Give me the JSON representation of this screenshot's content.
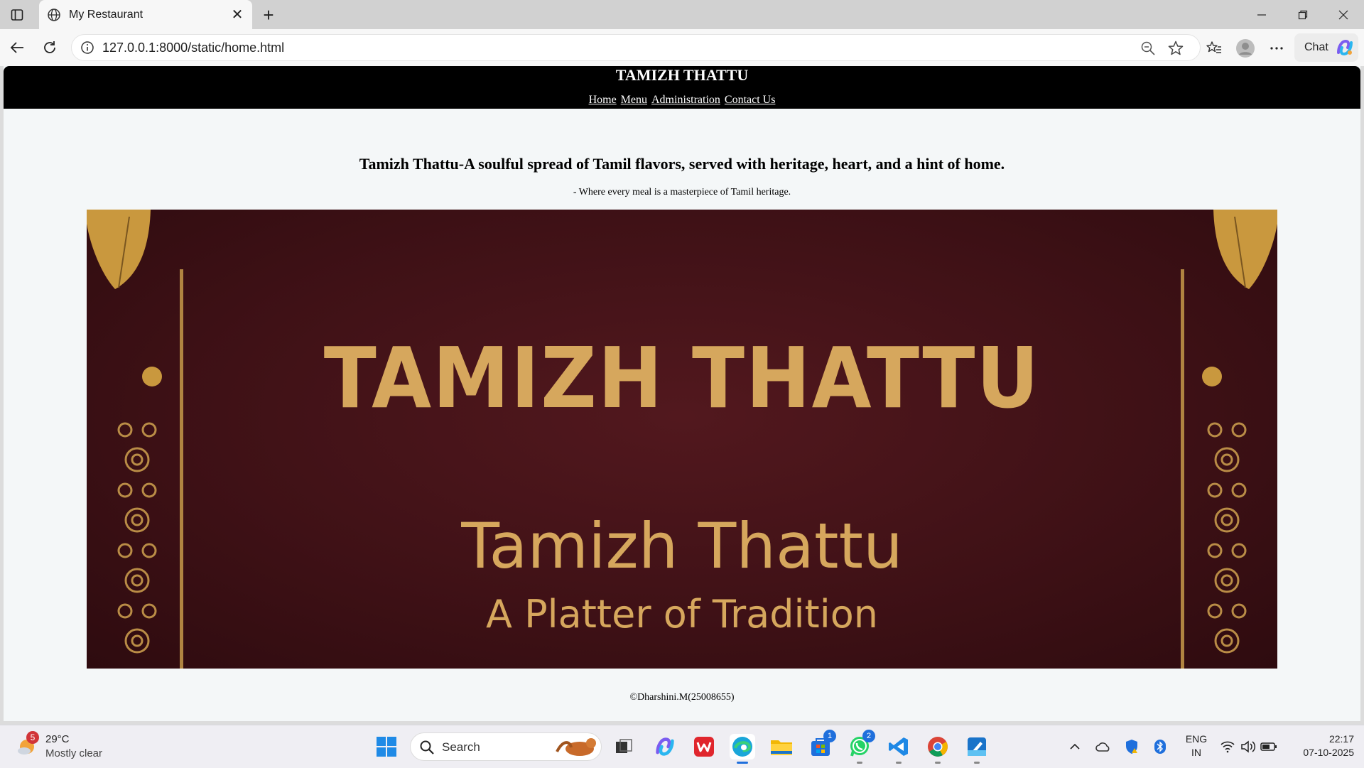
{
  "browser": {
    "tab_title": "My Restaurant",
    "url": "127.0.0.1:8000/static/home.html",
    "chat_label": "Chat"
  },
  "site": {
    "title": "TAMIZH THATTU",
    "nav": [
      "Home",
      "Menu",
      "Administration",
      "Contact Us"
    ],
    "tagline": "Tamizh Thattu-A soulful spread of Tamil flavors, served with heritage, heart, and a hint of home.",
    "subtagline": "- Where every meal is a masterpiece of Tamil heritage.",
    "banner": {
      "title": "TAMIZH THATTU",
      "name": "Tamizh Thattu",
      "subtitle": "A Platter of Tradition",
      "colors": {
        "background": "#3f1116",
        "gold": "#d6a75d"
      }
    },
    "footer": "©Dharshini.M(25008655)"
  },
  "taskbar": {
    "weather": {
      "badge": "5",
      "temp": "29°C",
      "condition": "Mostly clear"
    },
    "search_placeholder": "Search",
    "badges": {
      "store": "1",
      "whatsapp": "2"
    },
    "lang_line1": "ENG",
    "lang_line2": "IN",
    "time": "22:17",
    "date": "07-10-2025"
  }
}
